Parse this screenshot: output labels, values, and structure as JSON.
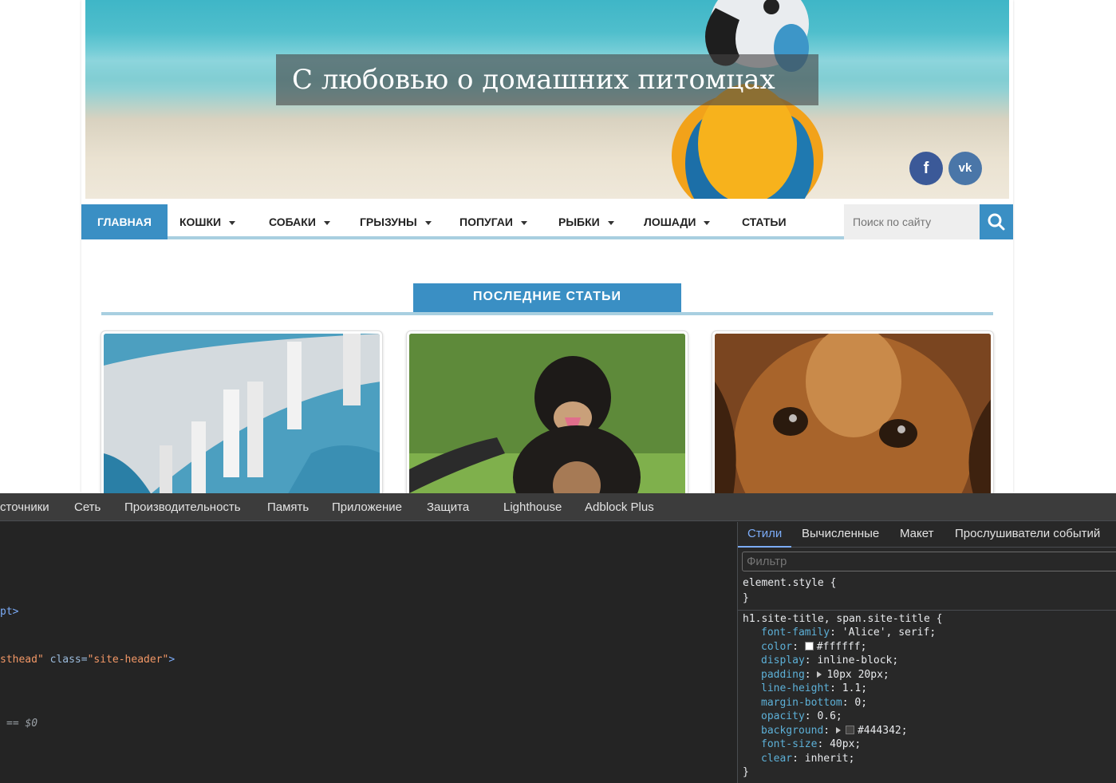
{
  "site": {
    "title": "С любовью о домашних питомцах",
    "social": {
      "facebook": "f",
      "vk": "vk"
    },
    "nav": [
      {
        "label": "ГЛАВНАЯ",
        "has_dropdown": false,
        "active": true
      },
      {
        "label": "КОШКИ",
        "has_dropdown": true
      },
      {
        "label": "СОБАКИ",
        "has_dropdown": true
      },
      {
        "label": "ГРЫЗУНЫ",
        "has_dropdown": true
      },
      {
        "label": "ПОПУГАИ",
        "has_dropdown": true
      },
      {
        "label": "РЫБКИ",
        "has_dropdown": true
      },
      {
        "label": "ЛОШАДИ",
        "has_dropdown": true
      },
      {
        "label": "СТАТЬИ",
        "has_dropdown": false
      }
    ],
    "search_placeholder": "Поиск по сайту",
    "section_title": "ПОСЛЕДНИЕ СТАТЬИ",
    "colors": {
      "accent": "#3a8fc4",
      "title_bg": "#444342",
      "underline": "#a8cfe0"
    }
  },
  "devtools": {
    "tabs": [
      "сточники",
      "Сеть",
      "Производительность",
      "Память",
      "Приложение",
      "Защита",
      "Lighthouse",
      "Adblock Plus"
    ],
    "dom": {
      "line1": "pt>",
      "line2_id": "sthead\"",
      "line2_attr": "class=",
      "line2_val": "\"site-header\"",
      "line2_end": ">",
      "line3": "== $0"
    },
    "styles": {
      "tabs": [
        "Стили",
        "Вычисленные",
        "Макет",
        "Прослушиватели событий"
      ],
      "filter_placeholder": "Фильтр",
      "element_style_open": "element.style {",
      "element_style_close": "}",
      "rule_selector": "h1.site-title, span.site-title {",
      "rule_close": "}",
      "props": [
        {
          "name": "font-family",
          "value": "'Alice', serif;"
        },
        {
          "name": "color",
          "value": "#ffffff;"
        },
        {
          "name": "display",
          "value": "inline-block;"
        },
        {
          "name": "padding",
          "value": "10px 20px;"
        },
        {
          "name": "line-height",
          "value": "1.1;"
        },
        {
          "name": "margin-bottom",
          "value": "0;"
        },
        {
          "name": "opacity",
          "value": "0.6;"
        },
        {
          "name": "background",
          "value": "#444342;"
        },
        {
          "name": "font-size",
          "value": "40px;"
        },
        {
          "name": "clear",
          "value": "inherit;"
        }
      ]
    }
  }
}
